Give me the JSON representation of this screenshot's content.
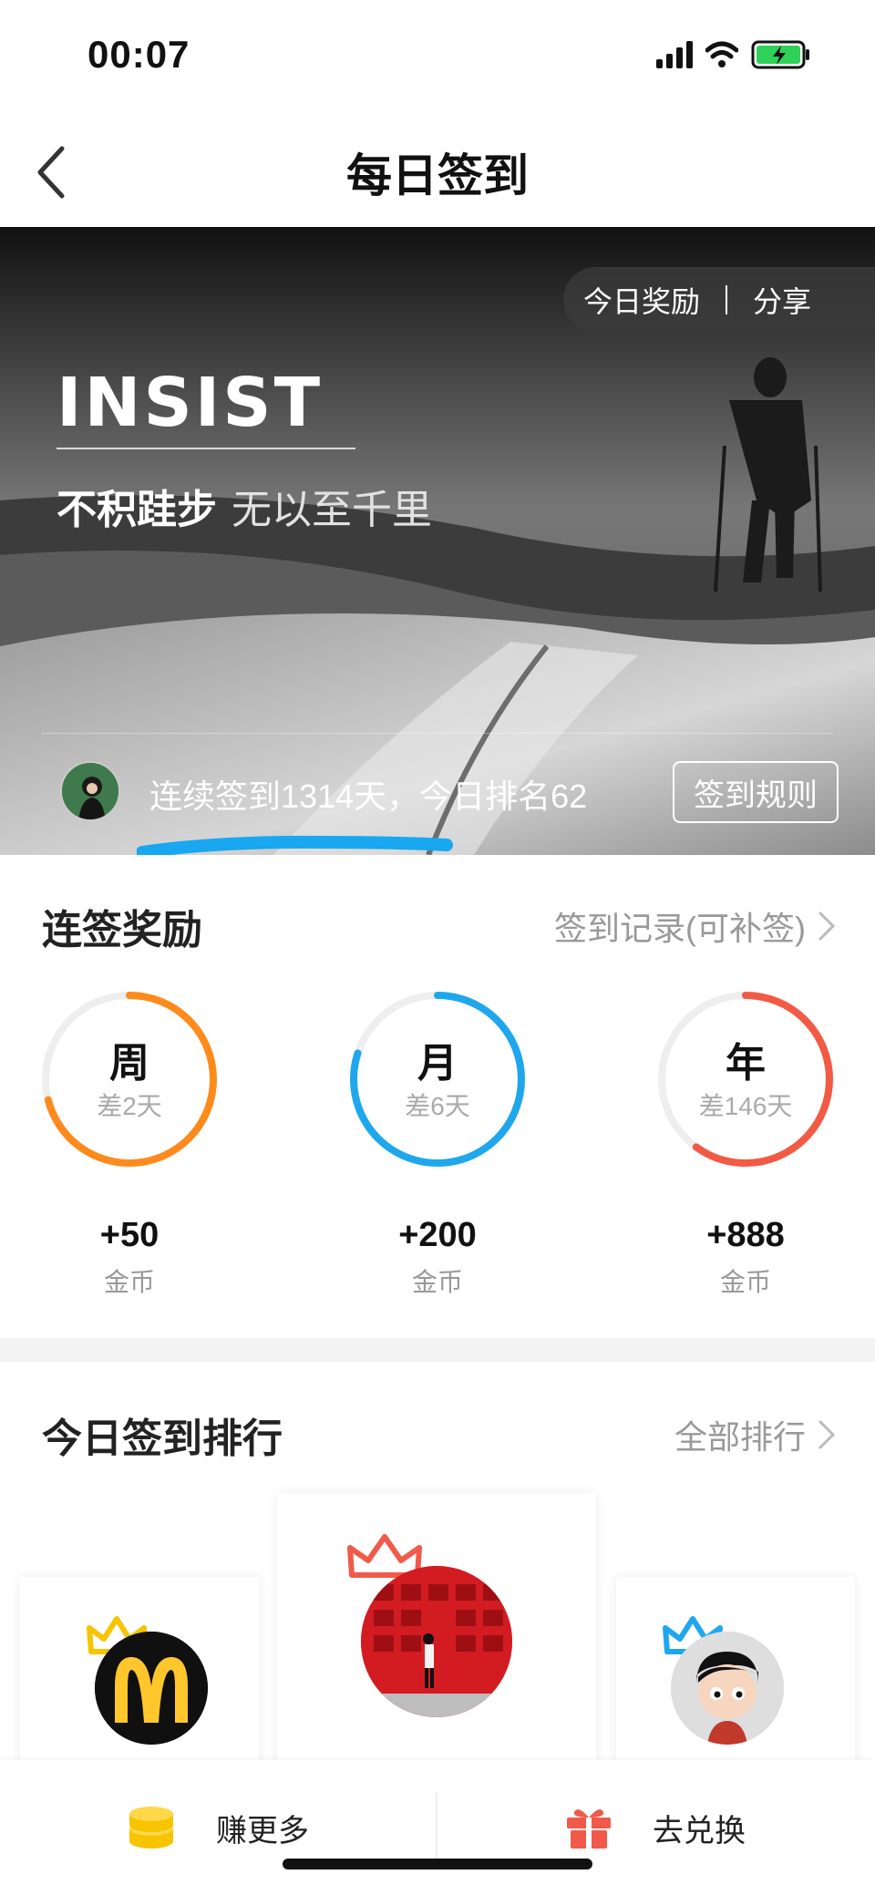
{
  "status_bar": {
    "time": "00:07"
  },
  "nav": {
    "title": "每日签到"
  },
  "banner": {
    "today_reward": "今日奖励",
    "share": "分享",
    "headline": "INSIST",
    "slogan_main": "不积跬步",
    "slogan_sub": "无以至千里",
    "streak_text": "连续签到1314天，今日排名62",
    "rules_button": "签到规则"
  },
  "rewards": {
    "title": "连签奖励",
    "record_link": "签到记录(可补签)",
    "items": [
      {
        "label": "周",
        "diff": "差2天",
        "coins": "+50",
        "unit": "金币",
        "color": "#FF8A1C",
        "progress": 0.71
      },
      {
        "label": "月",
        "diff": "差6天",
        "coins": "+200",
        "unit": "金币",
        "color": "#1EA7EC",
        "progress": 0.8
      },
      {
        "label": "年",
        "diff": "差146天",
        "coins": "+888",
        "unit": "金币",
        "color": "#F25A45",
        "progress": 0.6
      }
    ]
  },
  "ranking": {
    "title": "今日签到排行",
    "all_link": "全部排行"
  },
  "bottom_bar": {
    "earn_more": "赚更多",
    "exchange": "去兑换"
  },
  "colors": {
    "accent_blue": "#1EA7EC",
    "gold": "#F6C400",
    "gift_red": "#F15A4A"
  }
}
